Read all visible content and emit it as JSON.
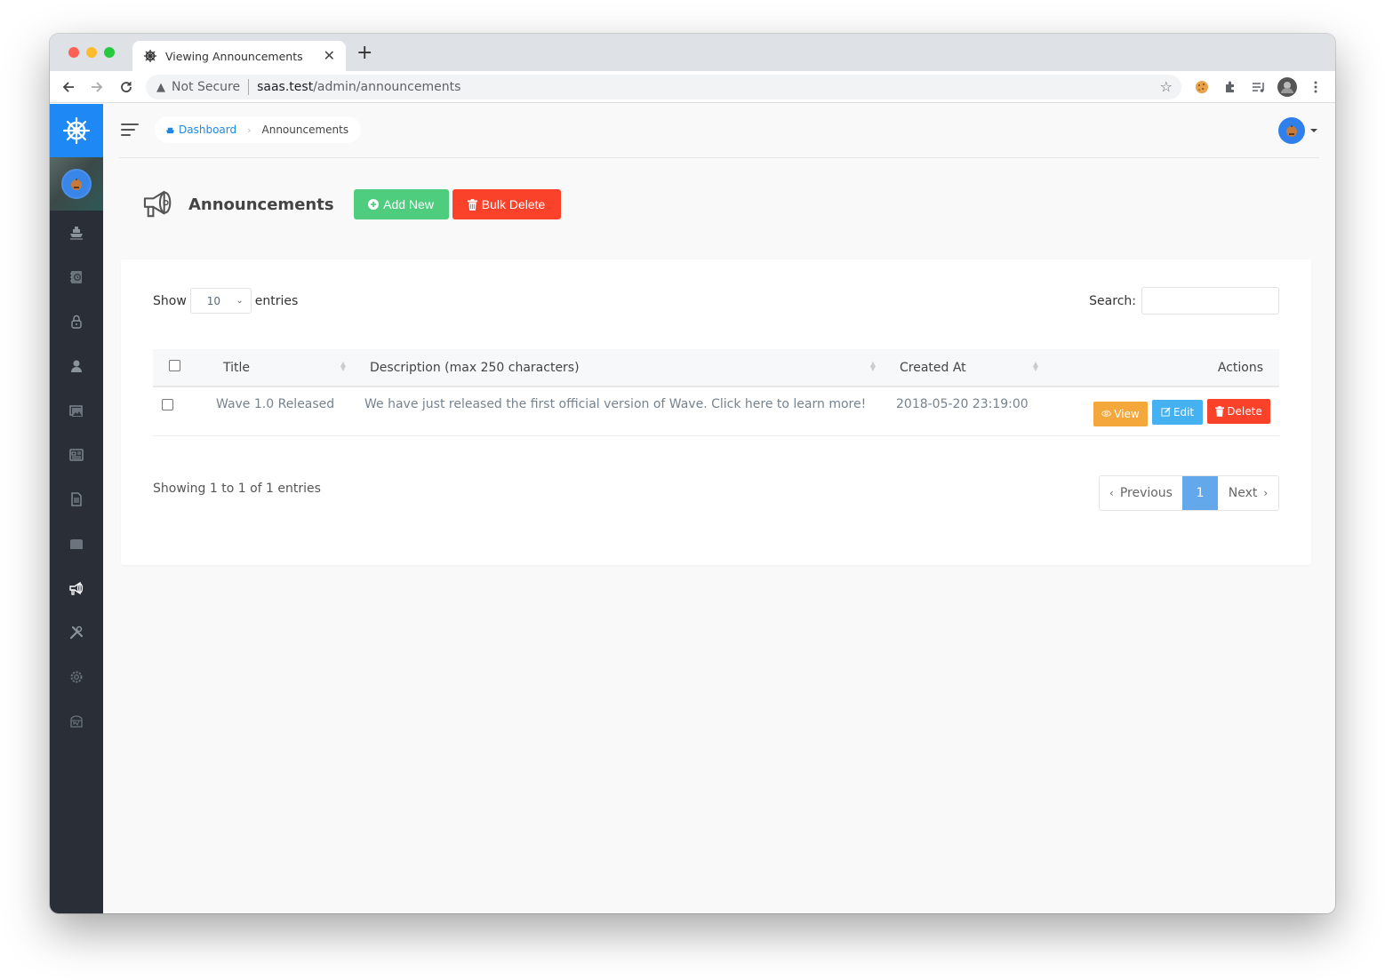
{
  "browser": {
    "tab_title": "Viewing Announcements",
    "url_security": "Not Secure",
    "url_host": "saas.test",
    "url_path": "/admin/announcements"
  },
  "sidebar": {
    "items": [
      {
        "icon": "boat-icon",
        "active": false
      },
      {
        "icon": "address-book-icon",
        "active": false
      },
      {
        "icon": "lock-icon",
        "active": false
      },
      {
        "icon": "person-icon",
        "active": false
      },
      {
        "icon": "images-icon",
        "active": false
      },
      {
        "icon": "news-icon",
        "active": false
      },
      {
        "icon": "document-icon",
        "active": false
      },
      {
        "icon": "folder-icon",
        "active": false
      },
      {
        "icon": "megaphone-icon",
        "active": true
      },
      {
        "icon": "tools-icon",
        "active": false
      },
      {
        "icon": "gear-icon",
        "active": false
      },
      {
        "icon": "bucket-icon",
        "active": false
      }
    ]
  },
  "breadcrumb": {
    "home": "Dashboard",
    "current": "Announcements"
  },
  "page": {
    "title": "Announcements",
    "add_new": "Add New",
    "bulk_delete": "Bulk Delete"
  },
  "table_controls": {
    "show_label": "Show",
    "page_length": "10",
    "entries_label": "entries",
    "search_label": "Search:",
    "search_value": ""
  },
  "table": {
    "columns": [
      "Title",
      "Description (max 250 characters)",
      "Created At",
      "Actions"
    ],
    "rows": [
      {
        "title": "Wave 1.0 Released",
        "description": "We have just released the first official version of Wave. Click here to learn more!",
        "created_at": "2018-05-20 23:19:00",
        "actions": {
          "view": "View",
          "edit": "Edit",
          "delete": "Delete"
        }
      }
    ]
  },
  "footer": {
    "info": "Showing 1 to 1 of 1 entries",
    "previous": "Previous",
    "current_page": "1",
    "next": "Next"
  },
  "colors": {
    "brand": "#1e88f5",
    "add_new": "#4fcd7f",
    "danger": "#fa4129",
    "warning": "#f4a73b",
    "info": "#46b1f0",
    "pager_active": "#62a8ea",
    "sidebar_bg": "#2a2f37"
  }
}
